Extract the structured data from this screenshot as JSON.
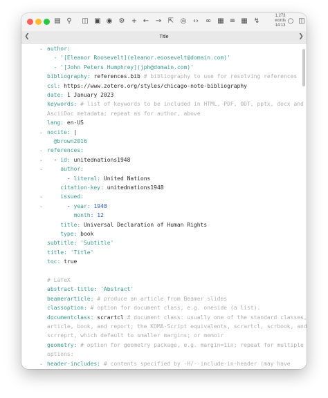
{
  "window": {
    "title": "Title",
    "word_count": {
      "count": "1,273",
      "unit": "words",
      "time": "14:13"
    },
    "traffic_lights": {
      "close": "#fe5f57",
      "minimize": "#febc2e",
      "zoom": "#28c840"
    }
  },
  "toolbar_icons": [
    "sidebar-icon",
    "search-icon",
    "folder-icon",
    "image-icon",
    "badge-icon",
    "settings-icon",
    "add-icon",
    "back-icon",
    "forward-icon",
    "share-icon",
    "preview-icon",
    "code-icon",
    "link-icon",
    "picture-icon",
    "list-icon",
    "table-icon",
    "export-icon",
    "status-icon",
    "split-view-icon"
  ],
  "editor": {
    "lines": [
      [
        {
          "t": "author:",
          "c": "k"
        }
      ],
      [
        {
          "t": "  - '[Eleanor Roosevelt](eleanor.eoosevelt@domain.com)'",
          "c": "s"
        }
      ],
      [
        {
          "t": "  - '[John Peters Humphrey](jph@domain.com)'",
          "c": "s"
        }
      ],
      [
        {
          "t": "bibliography: ",
          "c": "k"
        },
        {
          "t": "references.bib ",
          "c": "v"
        },
        {
          "t": "# bibliography to use for resolving references",
          "c": "c"
        }
      ],
      [
        {
          "t": "csl: ",
          "c": "k"
        },
        {
          "t": "https://www.zotero.org/styles/chicago-note-bibliography",
          "c": "v"
        }
      ],
      [
        {
          "t": "date: ",
          "c": "k"
        },
        {
          "t": "1 January 2023",
          "c": "v"
        }
      ],
      [
        {
          "t": "keywords: ",
          "c": "k"
        },
        {
          "t": "# list of keywords to be included in HTML, PDF, ODT, pptx, docx and",
          "c": "c"
        }
      ],
      [
        {
          "t": "AsciiDoc metadata; repeat as for author, above",
          "c": "c"
        }
      ],
      [
        {
          "t": "lang: ",
          "c": "k"
        },
        {
          "t": "en-US",
          "c": "v"
        }
      ],
      [
        {
          "t": "nocite: ",
          "c": "k"
        },
        {
          "t": "|",
          "c": "v"
        }
      ],
      [
        {
          "t": "  @brown2016",
          "c": "s"
        }
      ],
      [
        {
          "t": "references:",
          "c": "k"
        }
      ],
      [
        {
          "t": "  - ",
          "c": "v"
        },
        {
          "t": "id: ",
          "c": "k"
        },
        {
          "t": "unitednations1948",
          "c": "v"
        }
      ],
      [
        {
          "t": "    author:",
          "c": "k"
        }
      ],
      [
        {
          "t": "      - ",
          "c": "v"
        },
        {
          "t": "literal: ",
          "c": "k"
        },
        {
          "t": "United Nations",
          "c": "v"
        }
      ],
      [
        {
          "t": "    citation-key: ",
          "c": "k"
        },
        {
          "t": "unitednations1948",
          "c": "v"
        }
      ],
      [
        {
          "t": "    issued:",
          "c": "k"
        }
      ],
      [
        {
          "t": "      - ",
          "c": "v"
        },
        {
          "t": "year: ",
          "c": "k"
        },
        {
          "t": "1948",
          "c": "n"
        }
      ],
      [
        {
          "t": "        month: ",
          "c": "k"
        },
        {
          "t": "12",
          "c": "n"
        }
      ],
      [
        {
          "t": "    title: ",
          "c": "k"
        },
        {
          "t": "Universal Declaration of Human Rights",
          "c": "v"
        }
      ],
      [
        {
          "t": "    type: ",
          "c": "k"
        },
        {
          "t": "book",
          "c": "v"
        }
      ],
      [
        {
          "t": "subtitle: ",
          "c": "k"
        },
        {
          "t": "'Subtitle'",
          "c": "s"
        }
      ],
      [
        {
          "t": "title: ",
          "c": "k"
        },
        {
          "t": "'Title'",
          "c": "s"
        }
      ],
      [
        {
          "t": "toc: ",
          "c": "k"
        },
        {
          "t": "true",
          "c": "v"
        }
      ],
      [],
      [
        {
          "t": "# LaTeX",
          "c": "c"
        }
      ],
      [
        {
          "t": "abstract-title: ",
          "c": "k"
        },
        {
          "t": "'Abstract'",
          "c": "s"
        }
      ],
      [
        {
          "t": "beamerarticle: ",
          "c": "k"
        },
        {
          "t": "# produce an article from Beamer slides",
          "c": "c"
        }
      ],
      [
        {
          "t": "classoption: ",
          "c": "k"
        },
        {
          "t": "# option for document class, e.g. oneside (a list).",
          "c": "c"
        }
      ],
      [
        {
          "t": "documentclass: ",
          "c": "k"
        },
        {
          "t": "scrartcl ",
          "c": "v"
        },
        {
          "t": "# document class: usually one of the standard classes,",
          "c": "c"
        }
      ],
      [
        {
          "t": "article, book, and report; the KOMA-Script equivalents, scrartcl, scrbook, and",
          "c": "c"
        }
      ],
      [
        {
          "t": "scrreprt, which default to smaller margins; or memoir",
          "c": "c"
        }
      ],
      [
        {
          "t": "geometry: ",
          "c": "k"
        },
        {
          "t": "# option for geometry package, e.g. margin=1in; repeat for multiple",
          "c": "c"
        }
      ],
      [
        {
          "t": "options:",
          "c": "c"
        }
      ],
      [
        {
          "t": "header-includes: ",
          "c": "k"
        },
        {
          "t": "# contents specified by -H/--include-in-header (may have",
          "c": "c"
        }
      ]
    ],
    "fold_rows": [
      0,
      9,
      11,
      12,
      13,
      16,
      17,
      34
    ]
  }
}
